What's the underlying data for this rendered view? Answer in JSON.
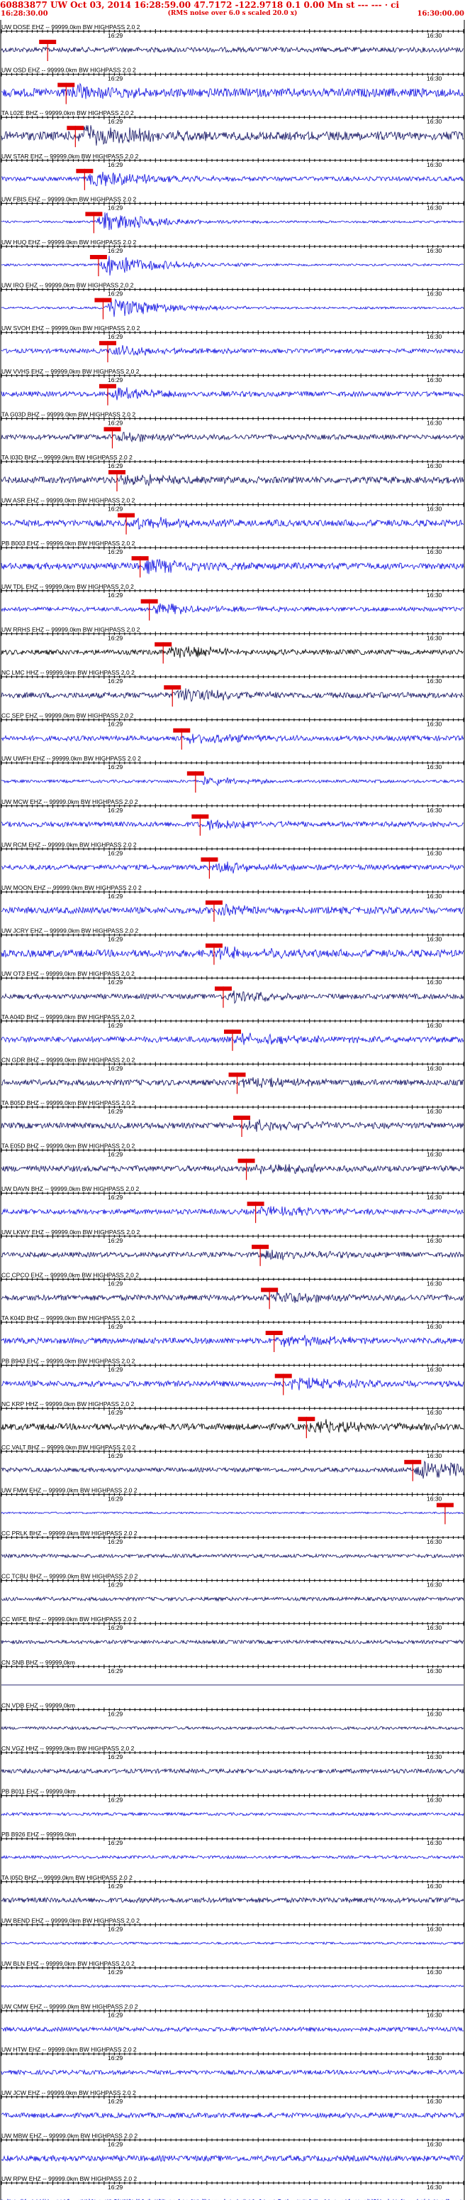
{
  "header": {
    "title": "60883877 UW Oct 03, 2014 16:28:59.00    47.7172  -122.9718  0.1 0.00 Mn st --- --- · ci",
    "start_time": "16:28:30.00",
    "rms_note": "(RMS noise over 6.0 s scaled 20.0 x)",
    "end_time": "16:30:00.00"
  },
  "time_labels": {
    "mid": "16:29",
    "end": "16:30"
  },
  "colors": {
    "header": "#e00000",
    "pick": "#e00000",
    "trace_blue": "#1010e0",
    "trace_navy": "#101060",
    "trace_black": "#000000"
  },
  "stations": [
    {
      "label": "UW DOSE EHZ -- 99999.0km BW  HIGHPASS  2.0  2",
      "color": "navy",
      "noise": 0.35,
      "event": 0,
      "pick": 0.1
    },
    {
      "label": "UW OSD EHZ -- 99999.0km BW  HIGHPASS  2.0  2",
      "color": "blue",
      "noise": 0.6,
      "event": 0.5,
      "pick": 0.14
    },
    {
      "label": "TA L02E BHZ -- 99999.0km BW  HIGHPASS  2.0  2",
      "color": "navy",
      "noise": 0.6,
      "event": 1,
      "pick": 0.16
    },
    {
      "label": "UW STAR EHZ -- 99999.0km BW  HIGHPASS  2.0  2",
      "color": "blue",
      "noise": 0.3,
      "event": 0.8,
      "pick": 0.18
    },
    {
      "label": "UW FBIS EHZ -- 99999.0km BW  HIGHPASS  2.0  2",
      "color": "blue",
      "noise": 0.15,
      "event": 1,
      "pick": 0.2
    },
    {
      "label": "UW HUQ EHZ -- 99999.0km BW  HIGHPASS  2.0  2",
      "color": "blue",
      "noise": 0.15,
      "event": 1,
      "pick": 0.21
    },
    {
      "label": "UW IRO EHZ -- 99999.0km BW  HIGHPASS  2.0  2",
      "color": "blue",
      "noise": 0.15,
      "event": 1,
      "pick": 0.22
    },
    {
      "label": "UW SVOH EHZ -- 99999.0km BW  HIGHPASS  2.0  2",
      "color": "blue",
      "noise": 0.3,
      "event": 0.5,
      "pick": 0.23
    },
    {
      "label": "UW VVHS EHZ -- 99999.0km BW  HIGHPASS  2.0  2",
      "color": "blue",
      "noise": 0.35,
      "event": 0.5,
      "pick": 0.23
    },
    {
      "label": "TA G03D BHZ -- 99999.0km BW  HIGHPASS  2.0  2",
      "color": "navy",
      "noise": 0.35,
      "event": 0.4,
      "pick": 0.24
    },
    {
      "label": "TA I03D BHZ -- 99999.0km BW  HIGHPASS  2.0  2",
      "color": "navy",
      "noise": 0.45,
      "event": 0.5,
      "pick": 0.25
    },
    {
      "label": "UW ASR EHZ -- 99999.0km BW  HIGHPASS  2.0  2",
      "color": "blue",
      "noise": 0.45,
      "event": 0.5,
      "pick": 0.27
    },
    {
      "label": "PB B003 EHZ -- 99999.0km BW  HIGHPASS  2.0  2",
      "color": "blue",
      "noise": 0.45,
      "event": 0.6,
      "pick": 0.3
    },
    {
      "label": "UW TDL EHZ -- 99999.0km BW  HIGHPASS  2.0  2",
      "color": "blue",
      "noise": 0.3,
      "event": 0.5,
      "pick": 0.32
    },
    {
      "label": "UW RRHS EHZ -- 99999.0km BW  HIGHPASS  2.0  2",
      "color": "black",
      "noise": 0.35,
      "event": 0.6,
      "pick": 0.35
    },
    {
      "label": "NC LMC HHZ -- 99999.0km BW  HIGHPASS  2.0  2",
      "color": "navy",
      "noise": 0.4,
      "event": 0.6,
      "pick": 0.37
    },
    {
      "label": "CC SEP EHZ -- 99999.0km BW  HIGHPASS  2.0  2",
      "color": "blue",
      "noise": 0.35,
      "event": 0.5,
      "pick": 0.39
    },
    {
      "label": "UW UWFH EHZ -- 99999.0km BW  HIGHPASS  2.0  2",
      "color": "blue",
      "noise": 0.2,
      "event": 0.4,
      "pick": 0.42
    },
    {
      "label": "UW MCW EHZ -- 99999.0km BW  HIGHPASS  2.0  2",
      "color": "blue",
      "noise": 0.35,
      "event": 0.5,
      "pick": 0.43
    },
    {
      "label": "UW RCM EHZ -- 99999.0km BW  HIGHPASS  2.0  2",
      "color": "blue",
      "noise": 0.35,
      "event": 0.5,
      "pick": 0.45
    },
    {
      "label": "UW MOON EHZ -- 99999.0km BW  HIGHPASS  2.0  2",
      "color": "blue",
      "noise": 0.45,
      "event": 0.5,
      "pick": 0.46
    },
    {
      "label": "UW JCRY EHZ -- 99999.0km BW  HIGHPASS  2.0  2",
      "color": "blue",
      "noise": 0.5,
      "event": 0.5,
      "pick": 0.46
    },
    {
      "label": "UW OT3 EHZ -- 99999.0km BW  HIGHPASS  2.0  2",
      "color": "navy",
      "noise": 0.35,
      "event": 0.5,
      "pick": 0.48
    },
    {
      "label": "TA A04D BHZ -- 99999.0km BW  HIGHPASS  2.0  2",
      "color": "blue",
      "noise": 0.4,
      "event": 0.6,
      "pick": 0.5
    },
    {
      "label": "CN GDR BHZ -- 99999.0km BW  HIGHPASS  2.0  2",
      "color": "navy",
      "noise": 0.4,
      "event": 0.5,
      "pick": 0.51
    },
    {
      "label": "TA B05D BHZ -- 99999.0km BW  HIGHPASS  2.0  2",
      "color": "navy",
      "noise": 0.4,
      "event": 0.5,
      "pick": 0.52
    },
    {
      "label": "TA E05D BHZ -- 99999.0km BW  HIGHPASS  2.0  2",
      "color": "navy",
      "noise": 0.4,
      "event": 0.5,
      "pick": 0.53
    },
    {
      "label": "UW DAVN BHZ -- 99999.0km BW  HIGHPASS  2.0  2",
      "color": "blue",
      "noise": 0.35,
      "event": 0.5,
      "pick": 0.55
    },
    {
      "label": "UW LKWY EHZ -- 99999.0km BW  HIGHPASS  2.0  2",
      "color": "navy",
      "noise": 0.35,
      "event": 0.5,
      "pick": 0.56
    },
    {
      "label": "CC CPCO EHZ -- 99999.0km BW  HIGHPASS  2.0  2",
      "color": "navy",
      "noise": 0.4,
      "event": 0.5,
      "pick": 0.58
    },
    {
      "label": "TA K04D BHZ -- 99999.0km BW  HIGHPASS  2.0  2",
      "color": "blue",
      "noise": 0.4,
      "event": 0.5,
      "pick": 0.59
    },
    {
      "label": "PB B943 EHZ -- 99999.0km BW  HIGHPASS  2.0  2",
      "color": "blue",
      "noise": 0.4,
      "event": 0.5,
      "pick": 0.61
    },
    {
      "label": "NC KRP HHZ -- 99999.0km BW  HIGHPASS  2.0  2",
      "color": "black",
      "noise": 0.45,
      "event": 0.6,
      "pick": 0.66
    },
    {
      "label": "CC VALT BHZ -- 99999.0km BW  HIGHPASS  2.0  2",
      "color": "navy",
      "noise": 0.3,
      "event": 1,
      "pick": 0.89
    },
    {
      "label": "UW FMW EHZ -- 99999.0km BW  HIGHPASS  2.0  2",
      "color": "blue",
      "noise": 0.12,
      "event": 0,
      "pick": 0.96
    },
    {
      "label": "CC PRLK BHZ -- 99999.0km BW  HIGHPASS  2.0  2",
      "color": "navy",
      "noise": 0.25,
      "event": 0,
      "pick": null
    },
    {
      "label": "CC TCBU BHZ -- 99999.0km BW  HIGHPASS  2.0  2",
      "color": "navy",
      "noise": 0.25,
      "event": 0,
      "pick": null
    },
    {
      "label": "CC WIFE BHZ -- 99999.0km BW  HIGHPASS  2.0  2",
      "color": "navy",
      "noise": 0.25,
      "event": 0,
      "pick": null
    },
    {
      "label": "CN SNB BHZ -- 99999.0km",
      "color": "navy",
      "noise": 0.0,
      "event": 0,
      "pick": null
    },
    {
      "label": "CN VDB EHZ -- 99999.0km",
      "color": "navy",
      "noise": 0.2,
      "event": 0,
      "pick": null
    },
    {
      "label": "CN VGZ HHZ -- 99999.0km BW  HIGHPASS  2.0  2",
      "color": "navy",
      "noise": 0.3,
      "event": 0,
      "pick": null
    },
    {
      "label": "PB B011 EHZ -- 99999.0km",
      "color": "blue",
      "noise": 0.2,
      "event": 0,
      "pick": null
    },
    {
      "label": "PB B926 EHZ -- 99999.0km",
      "color": "blue",
      "noise": 0.2,
      "event": 0,
      "pick": null
    },
    {
      "label": "TA I05D BHZ -- 99999.0km BW  HIGHPASS  2.0  2",
      "color": "navy",
      "noise": 0.35,
      "event": 0,
      "pick": null
    },
    {
      "label": "UW BEND EHZ -- 99999.0km BW  HIGHPASS  2.0  2",
      "color": "blue",
      "noise": 0.15,
      "event": 0,
      "pick": null
    },
    {
      "label": "UW BLN EHZ -- 99999.0km BW  HIGHPASS  2.0  2",
      "color": "blue",
      "noise": 0.15,
      "event": 0,
      "pick": null
    },
    {
      "label": "UW CMW EHZ -- 99999.0km BW  HIGHPASS  2.0  2",
      "color": "blue",
      "noise": 0.3,
      "event": 0,
      "pick": null
    },
    {
      "label": "UW HTW EHZ -- 99999.0km BW  HIGHPASS  2.0  2",
      "color": "blue",
      "noise": 0.3,
      "event": 0,
      "pick": null
    },
    {
      "label": "UW JCW EHZ -- 99999.0km BW  HIGHPASS  2.0  2",
      "color": "blue",
      "noise": 0.35,
      "event": 0,
      "pick": null
    },
    {
      "label": "UW MBW EHZ -- 99999.0km BW  HIGHPASS  2.0  2",
      "color": "blue",
      "noise": 0.4,
      "event": 0,
      "pick": null
    },
    {
      "label": "UW RPW EHZ -- 99999.0km BW  HIGHPASS  2.0  2",
      "color": "blue",
      "noise": 0.3,
      "event": 0,
      "pick": null
    }
  ]
}
